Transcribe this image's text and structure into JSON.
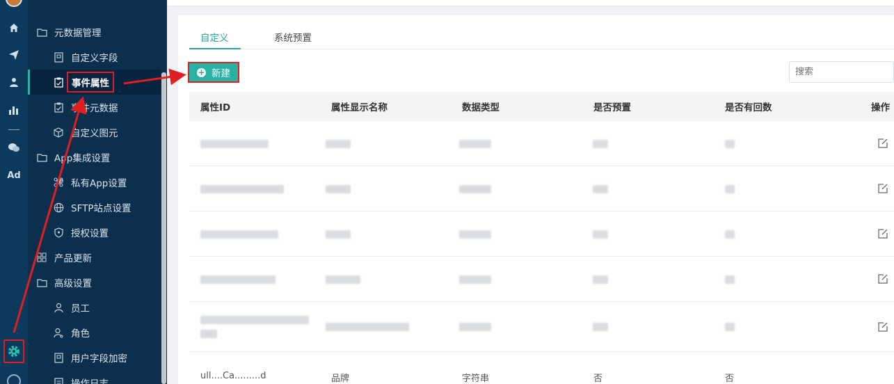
{
  "rail": {
    "icons": [
      "home-icon",
      "send-icon",
      "user-icon",
      "bar-chart-icon",
      "divider",
      "wechat-icon",
      "ad-icon",
      "gear-icon",
      "chat-icon"
    ],
    "ad_label": "Ad"
  },
  "submenu": {
    "items": [
      {
        "label": "元数据管理",
        "icon": "folder-icon",
        "level": 1
      },
      {
        "label": "自定义字段",
        "icon": "form-icon",
        "level": 2
      },
      {
        "label": "事件属性",
        "icon": "clipboard-icon",
        "level": 2,
        "active": true
      },
      {
        "label": "事件元数据",
        "icon": "clipboard-icon",
        "level": 2
      },
      {
        "label": "自定义图元",
        "icon": "cube-icon",
        "level": 2
      },
      {
        "label": "App集成设置",
        "icon": "folder-icon",
        "level": 1
      },
      {
        "label": "私有App设置",
        "icon": "command-icon",
        "level": 2
      },
      {
        "label": "SFTP站点设置",
        "icon": "globe-icon",
        "level": 2
      },
      {
        "label": "授权设置",
        "icon": "shield-icon",
        "level": 2
      },
      {
        "label": "产品更新",
        "icon": "grid-icon",
        "level": 1
      },
      {
        "label": "高级设置",
        "icon": "folder-icon",
        "level": 1
      },
      {
        "label": "员工",
        "icon": "person-icon",
        "level": 2
      },
      {
        "label": "角色",
        "icon": "person-key-icon",
        "level": 2
      },
      {
        "label": "用户字段加密",
        "icon": "form-icon",
        "level": 2
      },
      {
        "label": "操作日志",
        "icon": "log-icon",
        "level": 2
      }
    ]
  },
  "tabs": [
    {
      "label": "自定义",
      "active": true
    },
    {
      "label": "系统预置",
      "active": false
    }
  ],
  "toolbar": {
    "new_label": "新建",
    "search_placeholder": "搜索"
  },
  "table": {
    "columns": [
      "属性ID",
      "属性显示名称",
      "数据类型",
      "是否预置",
      "是否有回数",
      "操作"
    ],
    "partial_row": [
      "ull....Ca.........d",
      "品牌",
      "字符串",
      "否",
      "否"
    ]
  },
  "colors": {
    "accent": "#26a69a",
    "annotation": "#e02020",
    "rail": "#0d3a5c",
    "submenu": "#0b2f4d"
  }
}
